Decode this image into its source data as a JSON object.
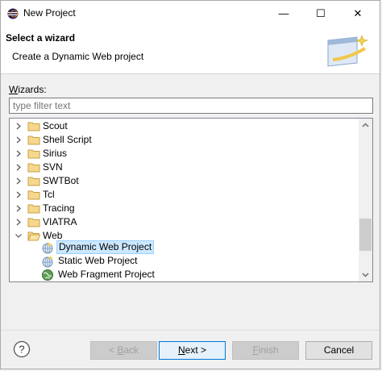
{
  "window": {
    "title": "New Project",
    "controls": {
      "minimize": "—",
      "maximize": "☐",
      "close": "✕"
    }
  },
  "banner": {
    "heading": "Select a wizard",
    "description": "Create a Dynamic Web project"
  },
  "wizards": {
    "label_mnemonic": "W",
    "label_rest": "izards:",
    "filter_placeholder": "type filter text"
  },
  "tree": {
    "categories": [
      {
        "label": "Scout",
        "expanded": false
      },
      {
        "label": "Shell Script",
        "expanded": false
      },
      {
        "label": "Sirius",
        "expanded": false
      },
      {
        "label": "SVN",
        "expanded": false
      },
      {
        "label": "SWTBot",
        "expanded": false
      },
      {
        "label": "Tcl",
        "expanded": false
      },
      {
        "label": "Tracing",
        "expanded": false
      },
      {
        "label": "VIATRA",
        "expanded": false
      },
      {
        "label": "Web",
        "expanded": true
      }
    ],
    "web_children": [
      {
        "label": "Dynamic Web Project",
        "selected": true,
        "icon": "dynamic-web-project-icon"
      },
      {
        "label": "Static Web Project",
        "selected": false,
        "icon": "static-web-project-icon"
      },
      {
        "label": "Web Fragment Project",
        "selected": false,
        "icon": "web-fragment-project-icon"
      }
    ]
  },
  "buttons": {
    "back_mnemonic": "B",
    "back_prefix": "< ",
    "back_rest": "ack",
    "next_mnemonic": "N",
    "next_rest": "ext >",
    "finish_mnemonic": "F",
    "finish_rest": "inish",
    "cancel": "Cancel",
    "help": "?"
  },
  "colors": {
    "selection_bg": "#cce8ff",
    "folder": "#e8b84a",
    "default_button_border": "#0078d7"
  }
}
